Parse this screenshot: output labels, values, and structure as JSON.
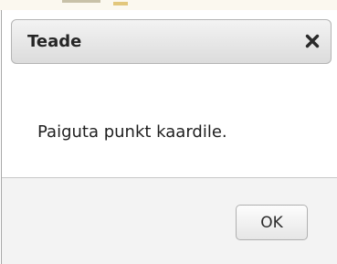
{
  "dialog": {
    "title": "Teade",
    "message": "Paiguta punkt kaardile.",
    "ok_label": "OK",
    "close_icon": "close-icon"
  }
}
